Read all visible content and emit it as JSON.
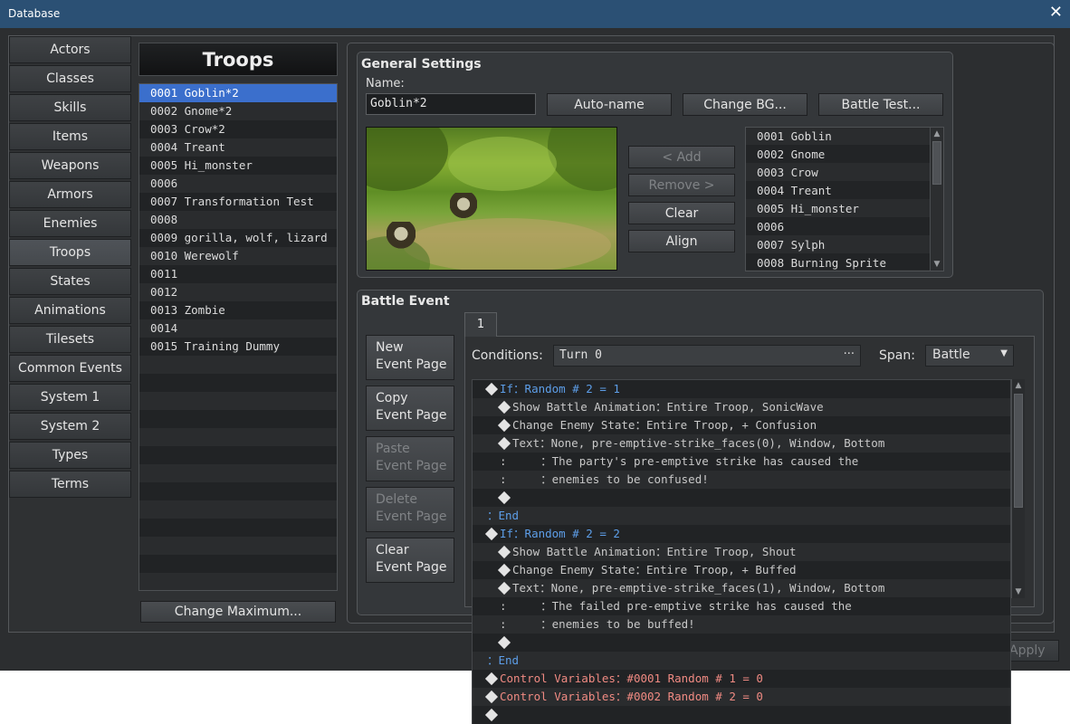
{
  "window": {
    "title": "Database",
    "close_glyph": "✕"
  },
  "categories": [
    "Actors",
    "Classes",
    "Skills",
    "Items",
    "Weapons",
    "Armors",
    "Enemies",
    "Troops",
    "States",
    "Animations",
    "Tilesets",
    "Common Events",
    "System 1",
    "System 2",
    "Types",
    "Terms"
  ],
  "selected_category": "Troops",
  "troops": {
    "title": "Troops",
    "items": [
      "0001 Goblin*2",
      "0002 Gnome*2",
      "0003 Crow*2",
      "0004 Treant",
      "0005 Hi_monster",
      "0006",
      "0007 Transformation Test",
      "0008",
      "0009 gorilla, wolf, lizard",
      "0010 Werewolf",
      "0011",
      "0012",
      "0013 Zombie",
      "0014",
      "0015 Training Dummy"
    ],
    "selected_index": 0,
    "change_max_label": "Change Maximum..."
  },
  "general": {
    "title": "General Settings",
    "name_label": "Name:",
    "name_value": "Goblin*2",
    "auto_name": "Auto-name",
    "change_bg": "Change BG...",
    "battle_test": "Battle Test...",
    "add": "< Add",
    "remove": "Remove >",
    "clear": "Clear",
    "align": "Align",
    "enemies": [
      "0001 Goblin",
      "0002 Gnome",
      "0003 Crow",
      "0004 Treant",
      "0005 Hi_monster",
      "0006",
      "0007 Sylph",
      "0008 Burning Sprite"
    ]
  },
  "battle_event": {
    "title": "Battle Event",
    "buttons": {
      "new": [
        "New",
        "Event Page"
      ],
      "copy": [
        "Copy",
        "Event Page"
      ],
      "paste": [
        "Paste",
        "Event Page"
      ],
      "delete": [
        "Delete",
        "Event Page"
      ],
      "clear": [
        "Clear",
        "Event Page"
      ]
    },
    "tab": "1",
    "conditions_label": "Conditions:",
    "conditions_value": "Turn 0",
    "conditions_more": "···",
    "span_label": "Span:",
    "span_value": "Battle",
    "commands": [
      {
        "indent": 0,
        "diamond": true,
        "color": "blue",
        "text": "If：Random # 2 = 1"
      },
      {
        "indent": 1,
        "diamond": true,
        "color": "gray",
        "text": "Show Battle Animation：Entire Troop, SonicWave"
      },
      {
        "indent": 1,
        "diamond": true,
        "color": "gray",
        "text": "Change Enemy State：Entire Troop, + Confusion"
      },
      {
        "indent": 1,
        "diamond": true,
        "color": "gray",
        "text": "Text：None, pre-emptive-strike_faces(0), Window, Bottom"
      },
      {
        "indent": 1,
        "diamond": false,
        "color": "gray",
        "text": ":     ：The party's pre-emptive strike has caused the"
      },
      {
        "indent": 1,
        "diamond": false,
        "color": "gray",
        "text": ":     ：enemies to be confused!"
      },
      {
        "indent": 1,
        "diamond": true,
        "color": "gray",
        "text": ""
      },
      {
        "indent": 0,
        "diamond": false,
        "color": "blue",
        "text": "：End"
      },
      {
        "indent": 0,
        "diamond": true,
        "color": "blue",
        "text": "If：Random # 2 = 2"
      },
      {
        "indent": 1,
        "diamond": true,
        "color": "gray",
        "text": "Show Battle Animation：Entire Troop, Shout"
      },
      {
        "indent": 1,
        "diamond": true,
        "color": "gray",
        "text": "Change Enemy State：Entire Troop, + Buffed"
      },
      {
        "indent": 1,
        "diamond": true,
        "color": "gray",
        "text": "Text：None, pre-emptive-strike_faces(1), Window, Bottom"
      },
      {
        "indent": 1,
        "diamond": false,
        "color": "gray",
        "text": ":     ：The failed pre-emptive strike has caused the"
      },
      {
        "indent": 1,
        "diamond": false,
        "color": "gray",
        "text": ":     ：enemies to be buffed!"
      },
      {
        "indent": 1,
        "diamond": true,
        "color": "gray",
        "text": ""
      },
      {
        "indent": 0,
        "diamond": false,
        "color": "blue",
        "text": "：End"
      },
      {
        "indent": 0,
        "diamond": true,
        "color": "red",
        "text": "Control Variables：#0001 Random # 1 = 0"
      },
      {
        "indent": 0,
        "diamond": true,
        "color": "red",
        "text": "Control Variables：#0002 Random # 2 = 0"
      },
      {
        "indent": 0,
        "diamond": true,
        "color": "gray",
        "text": ""
      }
    ]
  },
  "apply_label": "Apply",
  "colors": {
    "titlebar": "#2b5074",
    "selection": "#3b6fcc",
    "cond_blue": "#5d9ee8",
    "var_red": "#f08a82"
  }
}
